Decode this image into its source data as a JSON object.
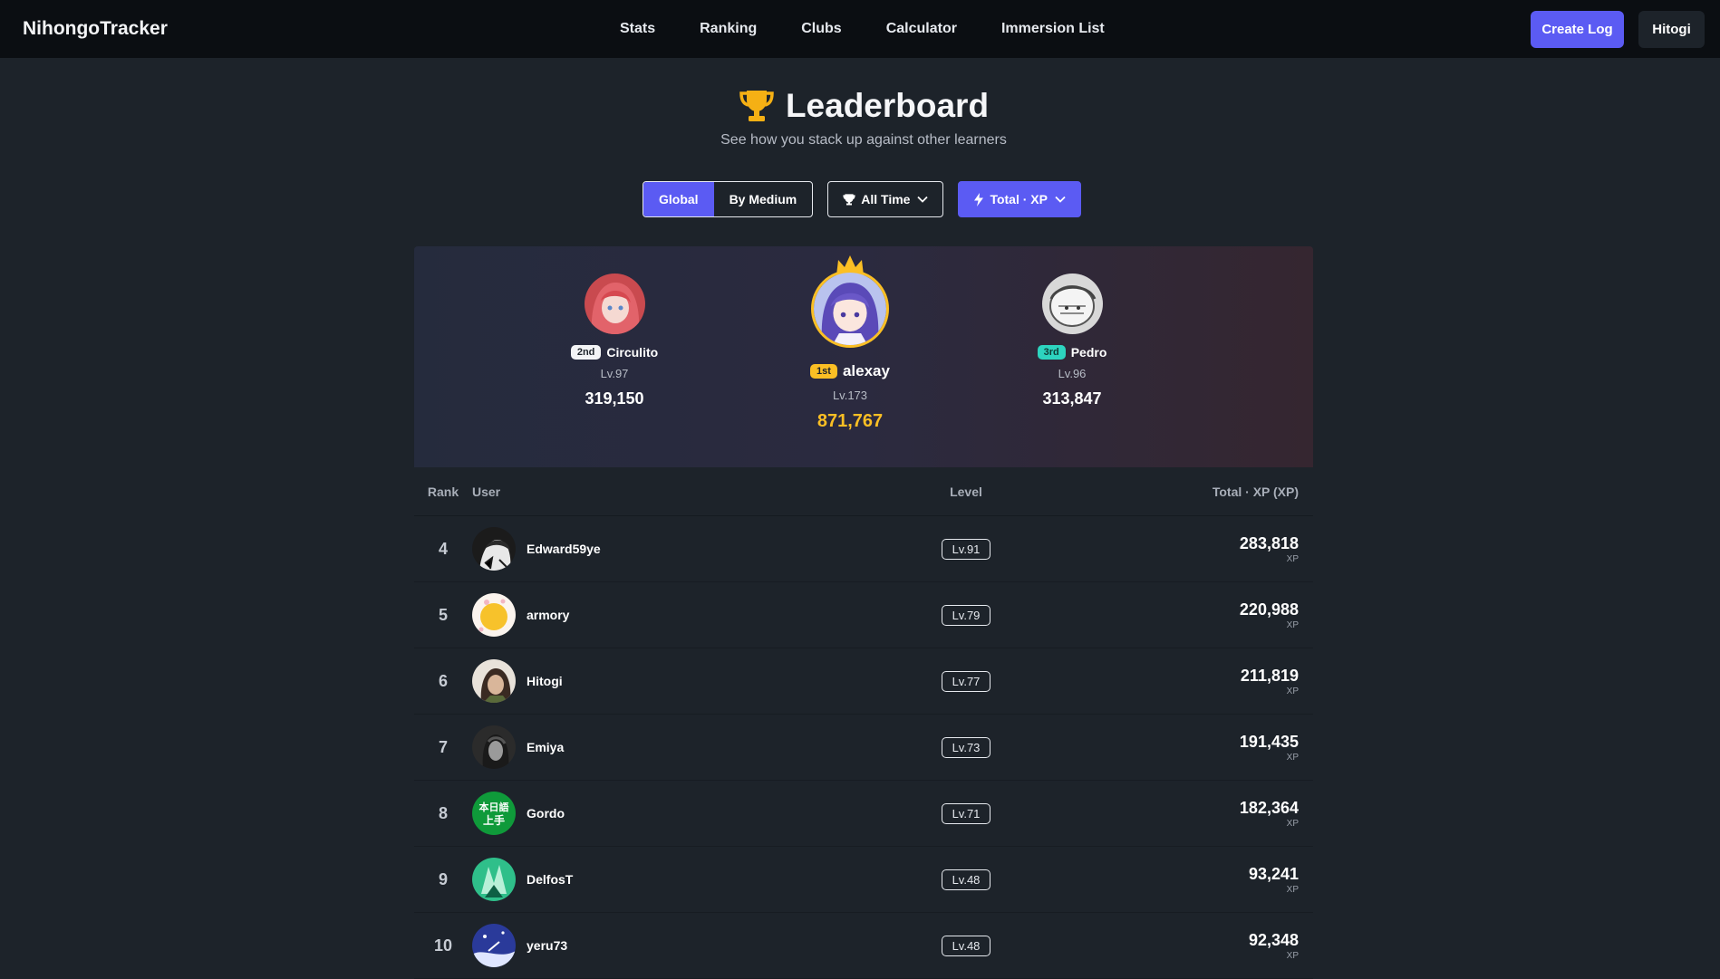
{
  "nav": {
    "brand": "NihongoTracker",
    "links": [
      "Stats",
      "Ranking",
      "Clubs",
      "Calculator",
      "Immersion List"
    ],
    "create_log": "Create Log",
    "user": "Hitogi"
  },
  "header": {
    "title": "Leaderboard",
    "subtitle": "See how you stack up against other learners"
  },
  "filters": {
    "scope_global": "Global",
    "scope_medium": "By Medium",
    "time": "All Time",
    "metric": "Total · XP"
  },
  "podium": {
    "first": {
      "badge": "1st",
      "name": "alexay",
      "level": "Lv.173",
      "xp": "871,767"
    },
    "second": {
      "badge": "2nd",
      "name": "Circulito",
      "level": "Lv.97",
      "xp": "319,150"
    },
    "third": {
      "badge": "3rd",
      "name": "Pedro",
      "level": "Lv.96",
      "xp": "313,847"
    }
  },
  "table": {
    "headers": {
      "rank": "Rank",
      "user": "User",
      "level": "Level",
      "xp": "Total · XP (XP)"
    },
    "rows": [
      {
        "rank": "4",
        "name": "Edward59ye",
        "level": "Lv.91",
        "xp": "283,818",
        "unit": "XP"
      },
      {
        "rank": "5",
        "name": "armory",
        "level": "Lv.79",
        "xp": "220,988",
        "unit": "XP"
      },
      {
        "rank": "6",
        "name": "Hitogi",
        "level": "Lv.77",
        "xp": "211,819",
        "unit": "XP"
      },
      {
        "rank": "7",
        "name": "Emiya",
        "level": "Lv.73",
        "xp": "191,435",
        "unit": "XP"
      },
      {
        "rank": "8",
        "name": "Gordo",
        "level": "Lv.71",
        "xp": "182,364",
        "unit": "XP",
        "avatar_text": [
          "本日語",
          "上手"
        ]
      },
      {
        "rank": "9",
        "name": "DelfosT",
        "level": "Lv.48",
        "xp": "93,241",
        "unit": "XP"
      },
      {
        "rank": "10",
        "name": "yeru73",
        "level": "Lv.48",
        "xp": "92,348",
        "unit": "XP"
      }
    ]
  },
  "colors": {
    "accent": "#5b5bf3",
    "gold": "#fbbf24",
    "teal": "#2dd4bf"
  }
}
